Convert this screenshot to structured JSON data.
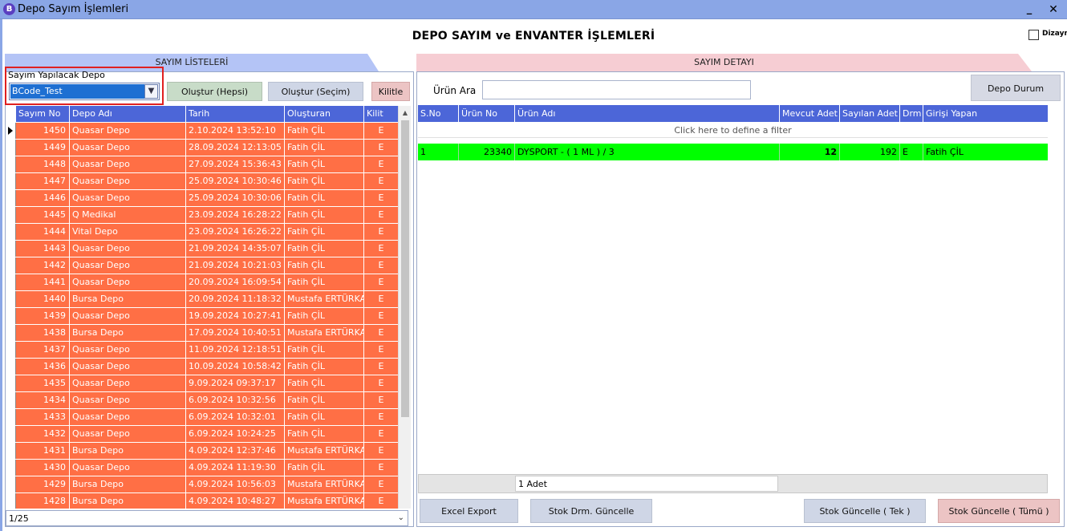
{
  "window": {
    "title": "Depo Sayım İşlemleri",
    "app_icon": "B",
    "minimize": "_",
    "close": "✕"
  },
  "main_title": "DEPO SAYIM ve ENVANTER İŞLEMLERİ",
  "dizayn_label": "Dizayn",
  "left": {
    "tab_label": "SAYIM LİSTELERİ",
    "depo_label": "Sayım Yapılacak Depo",
    "depo_selected": "BCode_Test",
    "btn_hepsi": "Oluştur (Hepsi)",
    "btn_secim": "Oluştur (Seçim)",
    "btn_kilit": "Kilitle",
    "columns": [
      "Sayım No",
      "Depo Adı",
      "Tarih",
      "Oluşturan",
      "Kilit"
    ],
    "rows": [
      [
        "1450",
        "Quasar Depo",
        "2.10.2024 13:52:10",
        "Fatih ÇİL",
        "E"
      ],
      [
        "1449",
        "Quasar Depo",
        "28.09.2024 12:13:05",
        "Fatih ÇİL",
        "E"
      ],
      [
        "1448",
        "Quasar Depo",
        "27.09.2024 15:36:43",
        "Fatih ÇİL",
        "E"
      ],
      [
        "1447",
        "Quasar Depo",
        "25.09.2024 10:30:46",
        "Fatih ÇİL",
        "E"
      ],
      [
        "1446",
        "Quasar Depo",
        "25.09.2024 10:30:06",
        "Fatih ÇİL",
        "E"
      ],
      [
        "1445",
        "Q Medikal",
        "23.09.2024 16:28:22",
        "Fatih ÇİL",
        "E"
      ],
      [
        "1444",
        "Vital Depo",
        "23.09.2024 16:26:22",
        "Fatih ÇİL",
        "E"
      ],
      [
        "1443",
        "Quasar Depo",
        "21.09.2024 14:35:07",
        "Fatih ÇİL",
        "E"
      ],
      [
        "1442",
        "Quasar Depo",
        "21.09.2024 10:21:03",
        "Fatih ÇİL",
        "E"
      ],
      [
        "1441",
        "Quasar Depo",
        "20.09.2024 16:09:54",
        "Fatih ÇİL",
        "E"
      ],
      [
        "1440",
        "Bursa Depo",
        "20.09.2024 11:18:32",
        "Mustafa ERTÜRKAN",
        "E"
      ],
      [
        "1439",
        "Quasar Depo",
        "19.09.2024 10:27:41",
        "Fatih ÇİL",
        "E"
      ],
      [
        "1438",
        "Bursa Depo",
        "17.09.2024 10:40:51",
        "Mustafa ERTÜRKAN",
        "E"
      ],
      [
        "1437",
        "Quasar Depo",
        "11.09.2024 12:18:51",
        "Fatih ÇİL",
        "E"
      ],
      [
        "1436",
        "Quasar Depo",
        "10.09.2024 10:58:42",
        "Fatih ÇİL",
        "E"
      ],
      [
        "1435",
        "Quasar Depo",
        "9.09.2024 09:37:17",
        "Fatih ÇİL",
        "E"
      ],
      [
        "1434",
        "Quasar Depo",
        "6.09.2024 10:32:56",
        "Fatih ÇİL",
        "E"
      ],
      [
        "1433",
        "Quasar Depo",
        "6.09.2024 10:32:01",
        "Fatih ÇİL",
        "E"
      ],
      [
        "1432",
        "Quasar Depo",
        "6.09.2024 10:24:25",
        "Fatih ÇİL",
        "E"
      ],
      [
        "1431",
        "Bursa Depo",
        "4.09.2024 12:37:46",
        "Mustafa ERTÜRKAN",
        "E"
      ],
      [
        "1430",
        "Quasar Depo",
        "4.09.2024 11:19:30",
        "Fatih ÇİL",
        "E"
      ],
      [
        "1429",
        "Bursa Depo",
        "4.09.2024 10:56:03",
        "Mustafa ERTÜRKAN",
        "E"
      ],
      [
        "1428",
        "Bursa Depo",
        "4.09.2024 10:48:27",
        "Mustafa ERTÜRKAN",
        "E"
      ]
    ],
    "row_color": "#ff6f45",
    "pager": "1/25"
  },
  "right": {
    "tab_label": "SAYIM DETAYI",
    "urun_ara_label": "Ürün Ara",
    "urun_ara_value": "",
    "btn_depo_durum": "Depo Durum",
    "columns": [
      "S.No",
      "Ürün No",
      "Ürün Adı",
      "Mevcut Adet",
      "Sayılan Adet",
      "Drm",
      "Girişi Yapan"
    ],
    "filter_hint": "Click here to define a filter",
    "rows": [
      [
        "1",
        "23340",
        "DYSPORT - ( 1 ML ) / 3",
        "12",
        "192",
        "E",
        "Fatih ÇİL"
      ]
    ],
    "row_color": "#00ff00",
    "count": "1 Adet",
    "btn_excel": "Excel Export",
    "btn_drm": "Stok Drm. Güncelle",
    "btn_tek": "Stok Güncelle ( Tek )",
    "btn_tumu": "Stok Güncelle ( Tümü )"
  }
}
